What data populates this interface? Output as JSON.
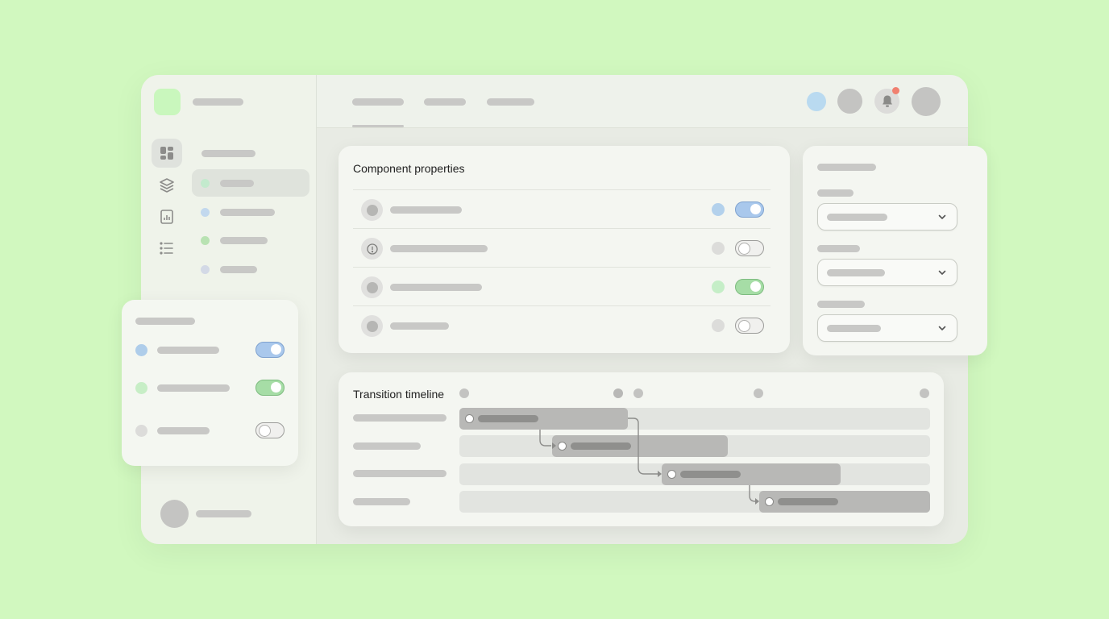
{
  "panels": {
    "properties_title": "Component properties",
    "timeline_title": "Transition timeline"
  },
  "properties": {
    "rows": [
      {
        "icon": "circle-icon",
        "status": "blue",
        "toggle": "on-blue"
      },
      {
        "icon": "info-icon",
        "status": "gray",
        "toggle": "off"
      },
      {
        "icon": "circle-icon",
        "status": "green",
        "toggle": "on-green"
      },
      {
        "icon": "circle-icon",
        "status": "gray",
        "toggle": "off"
      }
    ]
  },
  "floating_panel": {
    "rows": [
      {
        "status": "blue",
        "toggle": "on-blue"
      },
      {
        "status": "green",
        "toggle": "on-green"
      },
      {
        "status": "gray",
        "toggle": "off"
      }
    ]
  },
  "sidebar": {
    "icons": [
      "dashboard-icon",
      "layers-icon",
      "document-chart-icon",
      "list-icon"
    ],
    "items": [
      {
        "status": "green",
        "active": true
      },
      {
        "status": "blue",
        "active": false
      },
      {
        "status": "green",
        "active": false
      },
      {
        "status": "lavender",
        "active": false
      }
    ]
  },
  "header": {
    "notification_badge": true,
    "icons": [
      "bell-icon"
    ]
  },
  "colors": {
    "background": "#d1f8bf",
    "accent_blue": "#a9c8ec",
    "accent_green": "#a6dda6",
    "badge_red": "#f08070"
  }
}
